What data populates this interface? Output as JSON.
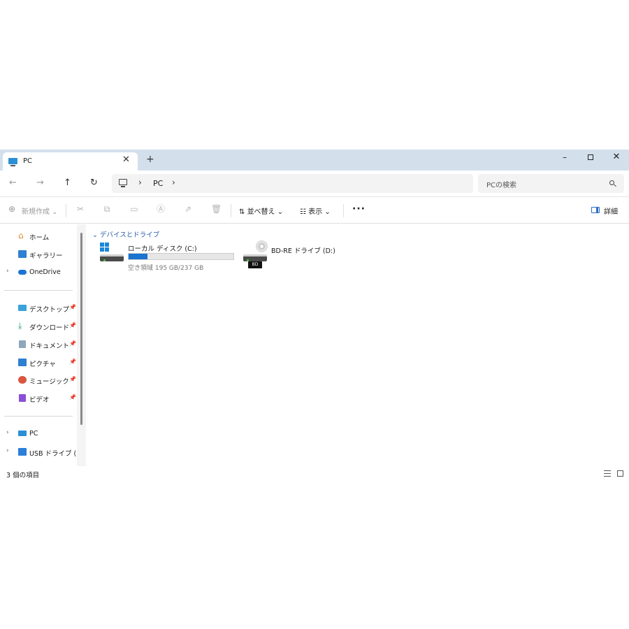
{
  "tab": {
    "title": "PC",
    "close": "✕",
    "new": "+"
  },
  "window_controls": {
    "minimize": "–",
    "close": "✕"
  },
  "nav": {
    "back": "←",
    "forward": "→",
    "up": "↑",
    "refresh": "↻"
  },
  "address": {
    "chevron1": "›",
    "location": "PC",
    "chevron2": "›"
  },
  "search": {
    "placeholder": "PCの検索"
  },
  "toolbar": {
    "new_label": "新規作成",
    "sort_label": "並べ替え",
    "view_label": "表示",
    "more": "···",
    "details_label": "詳細"
  },
  "sidebar": {
    "top": [
      {
        "label": "ホーム",
        "icon": "home-icon"
      },
      {
        "label": "ギャラリー",
        "icon": "gallery-icon"
      },
      {
        "label": "OneDrive",
        "icon": "cloud-icon"
      }
    ],
    "pinned": [
      {
        "label": "デスクトップ",
        "icon": "desktop-icon"
      },
      {
        "label": "ダウンロード",
        "icon": "download-icon"
      },
      {
        "label": "ドキュメント",
        "icon": "document-icon"
      },
      {
        "label": "ピクチャ",
        "icon": "pictures-icon"
      },
      {
        "label": "ミュージック",
        "icon": "music-icon"
      },
      {
        "label": "ビデオ",
        "icon": "video-icon"
      }
    ],
    "bottom": [
      {
        "label": "PC",
        "icon": "pc-icon"
      },
      {
        "label": "USB ドライブ (E:)",
        "icon": "usb-drive-icon"
      }
    ]
  },
  "main": {
    "group_header": "デバイスとドライブ",
    "drives": [
      {
        "name": "ローカル ディスク (C:)",
        "free_text": "空き領域 195 GB/237 GB",
        "used_fraction": 0.18
      },
      {
        "name": "BD-RE ドライブ (D:)",
        "badge": "BD"
      }
    ]
  },
  "status": {
    "count": "3 個の項目"
  },
  "colors": {
    "titlebar": "#d3e0ec",
    "accent": "#1a73d0",
    "group_header": "#2b5fa8"
  }
}
